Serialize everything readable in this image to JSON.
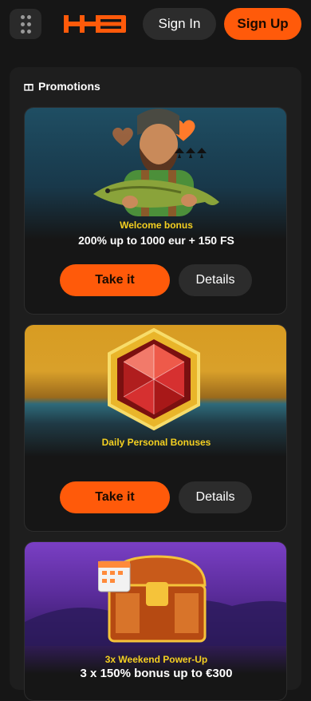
{
  "header": {
    "menu_icon": "grid-menu-icon",
    "logo_text": "HB",
    "sign_in": "Sign In",
    "sign_up": "Sign Up"
  },
  "promotions": {
    "title": "Promotions",
    "title_icon": "gift-icon",
    "cards": [
      {
        "subtitle": "Welcome bonus",
        "headline": "200% up to 1000 eur + 150 FS",
        "take": "Take it",
        "details": "Details",
        "art": "fisherman-character"
      },
      {
        "subtitle": "Daily Personal Bonuses",
        "headline": "",
        "take": "Take it",
        "details": "Details",
        "art": "red-gem"
      },
      {
        "subtitle": "3x Weekend Power-Up",
        "headline": "3 x 150% bonus up to €300",
        "art": "treasure-chest"
      }
    ]
  },
  "colors": {
    "accent": "#ff5a0a",
    "gold": "#f5d020",
    "background": "#161616"
  }
}
